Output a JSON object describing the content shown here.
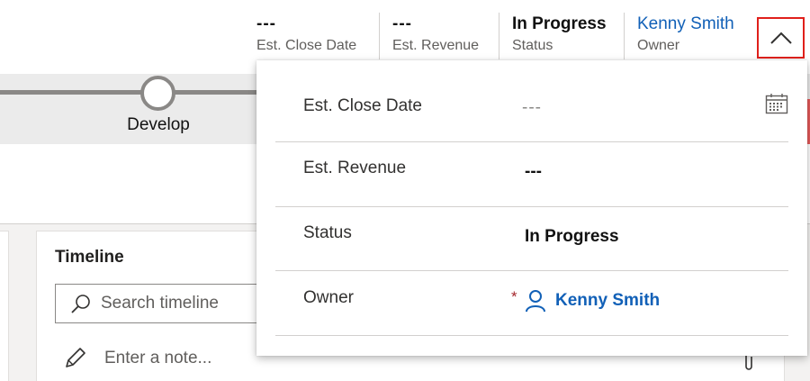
{
  "header": {
    "fields": [
      {
        "value": "---",
        "label": "Est. Close Date"
      },
      {
        "value": "---",
        "label": "Est. Revenue"
      },
      {
        "value": "In Progress",
        "label": "Status"
      },
      {
        "value": "Kenny Smith",
        "label": "Owner"
      }
    ],
    "expand_icon": "chevron-up-icon"
  },
  "process": {
    "stage_label": "Develop"
  },
  "timeline": {
    "title": "Timeline",
    "search_placeholder": "Search timeline",
    "note_placeholder": "Enter a note..."
  },
  "flyout": {
    "rows": [
      {
        "label": "Est. Close Date",
        "value": "---",
        "icon": "calendar-icon"
      },
      {
        "label": "Est. Revenue",
        "value": "---"
      },
      {
        "label": "Status",
        "value": "In Progress"
      },
      {
        "label": "Owner",
        "value": "Kenny Smith",
        "required_mark": "*",
        "icon": "user-icon"
      }
    ]
  },
  "colors": {
    "link": "#1160b7",
    "highlight_border": "#e0201b",
    "required": "#a4262c"
  }
}
